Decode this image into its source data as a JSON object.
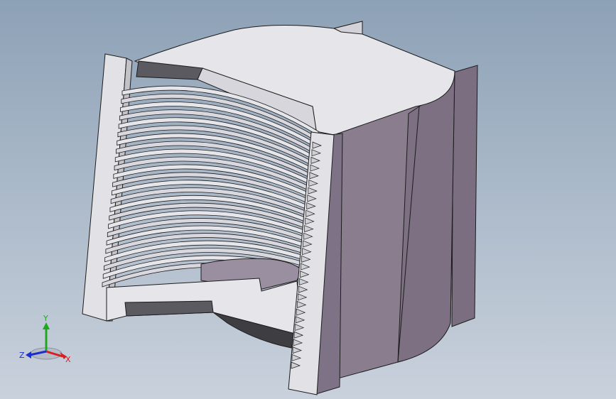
{
  "viewport": {
    "background_top": "#8da1b6",
    "background_bottom": "#c9d1dc"
  },
  "model": {
    "colors": {
      "cut_face": "#e6e6ea",
      "cut_face_shade": "#d2d2d8",
      "body_side": "#8a7e8e",
      "body_side_dark": "#6e6275",
      "inner_dark": "#3e3e42",
      "edge": "#1c1c1c"
    }
  },
  "triad": {
    "x_label": "X",
    "y_label": "Y",
    "z_label": "Z",
    "x_color": "#d42020",
    "y_color": "#1fa81f",
    "z_color": "#1a2fd0"
  }
}
